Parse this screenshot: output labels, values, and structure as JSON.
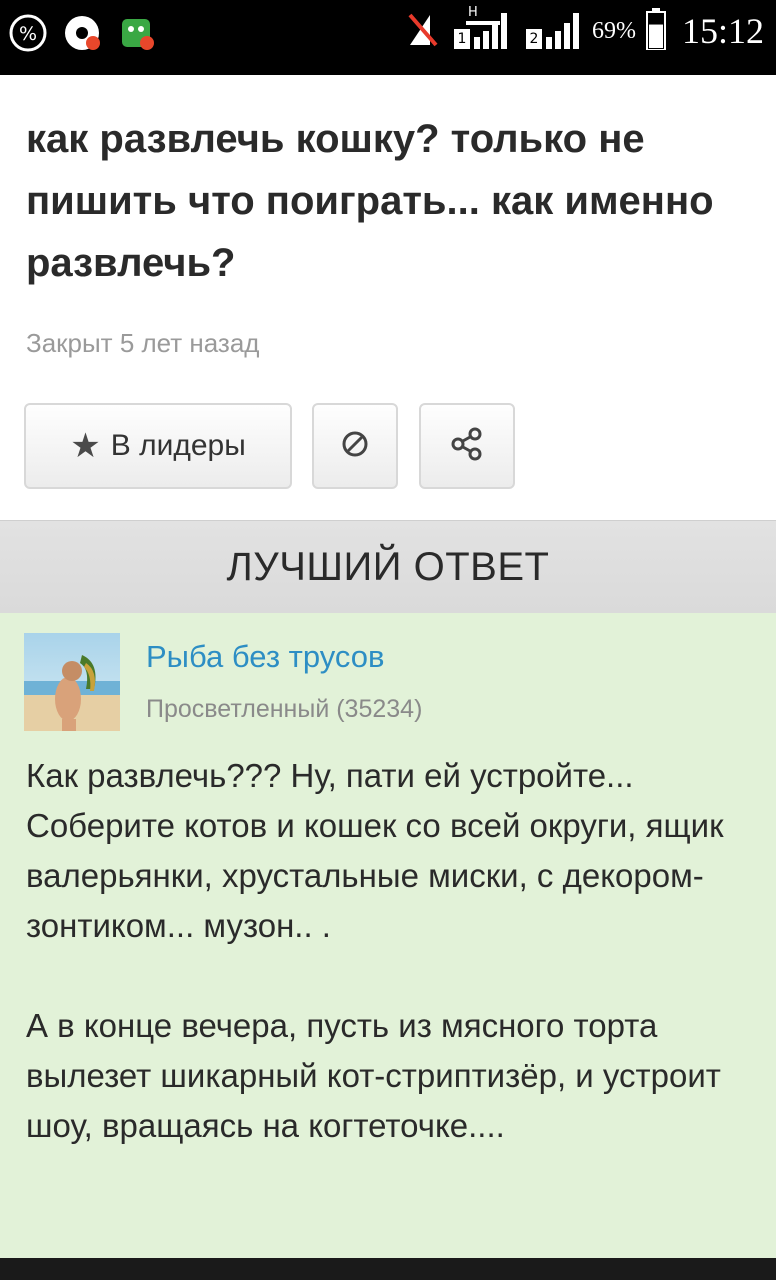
{
  "status_bar": {
    "left_icons": [
      "percent-notification-icon",
      "music-app-icon",
      "game-app-icon"
    ],
    "right_icons": [
      "no-signal-icon",
      "sim1-signal-icon",
      "sim2-signal-icon",
      "battery-icon"
    ],
    "sim1_network": "H",
    "sim1_label": "1",
    "sim2_label": "2",
    "battery_percent": "69%",
    "battery_level": 0.69,
    "time": "15:12"
  },
  "question": {
    "title": "как развлечь кошку? только не пишить что поиграть... как именно развлечь?",
    "meta": "Закрыт 5 лет назад"
  },
  "actions": {
    "leaders_label": "В лидеры",
    "leaders_icon": "star-icon",
    "block_icon": "block-icon",
    "share_icon": "share-icon"
  },
  "best_answer": {
    "header": "ЛУЧШИЙ ОТВЕТ",
    "author": {
      "name": "Рыба без трусов",
      "rank": "Просветленный (35234)"
    },
    "paragraphs": [
      "Как развлечь??? Ну, пати ей устройте... Соберите котов и кошек со всей округи, ящик валерьянки, хрустальные миски, с декором-зонтиком... музон.. .",
      "А в конце вечера, пусть из мясного торта вылезет шикарный кот-стриптизёр, и устроит шоу, вращаясь на когтеточке...."
    ]
  },
  "colors": {
    "status_bar_bg": "#000000",
    "title_text": "#2a2a2a",
    "meta_text": "#9a9a9a",
    "band_bg": "#dcdcdc",
    "answer_bg": "#e2f2d8",
    "author_link": "#2d8ec4"
  }
}
